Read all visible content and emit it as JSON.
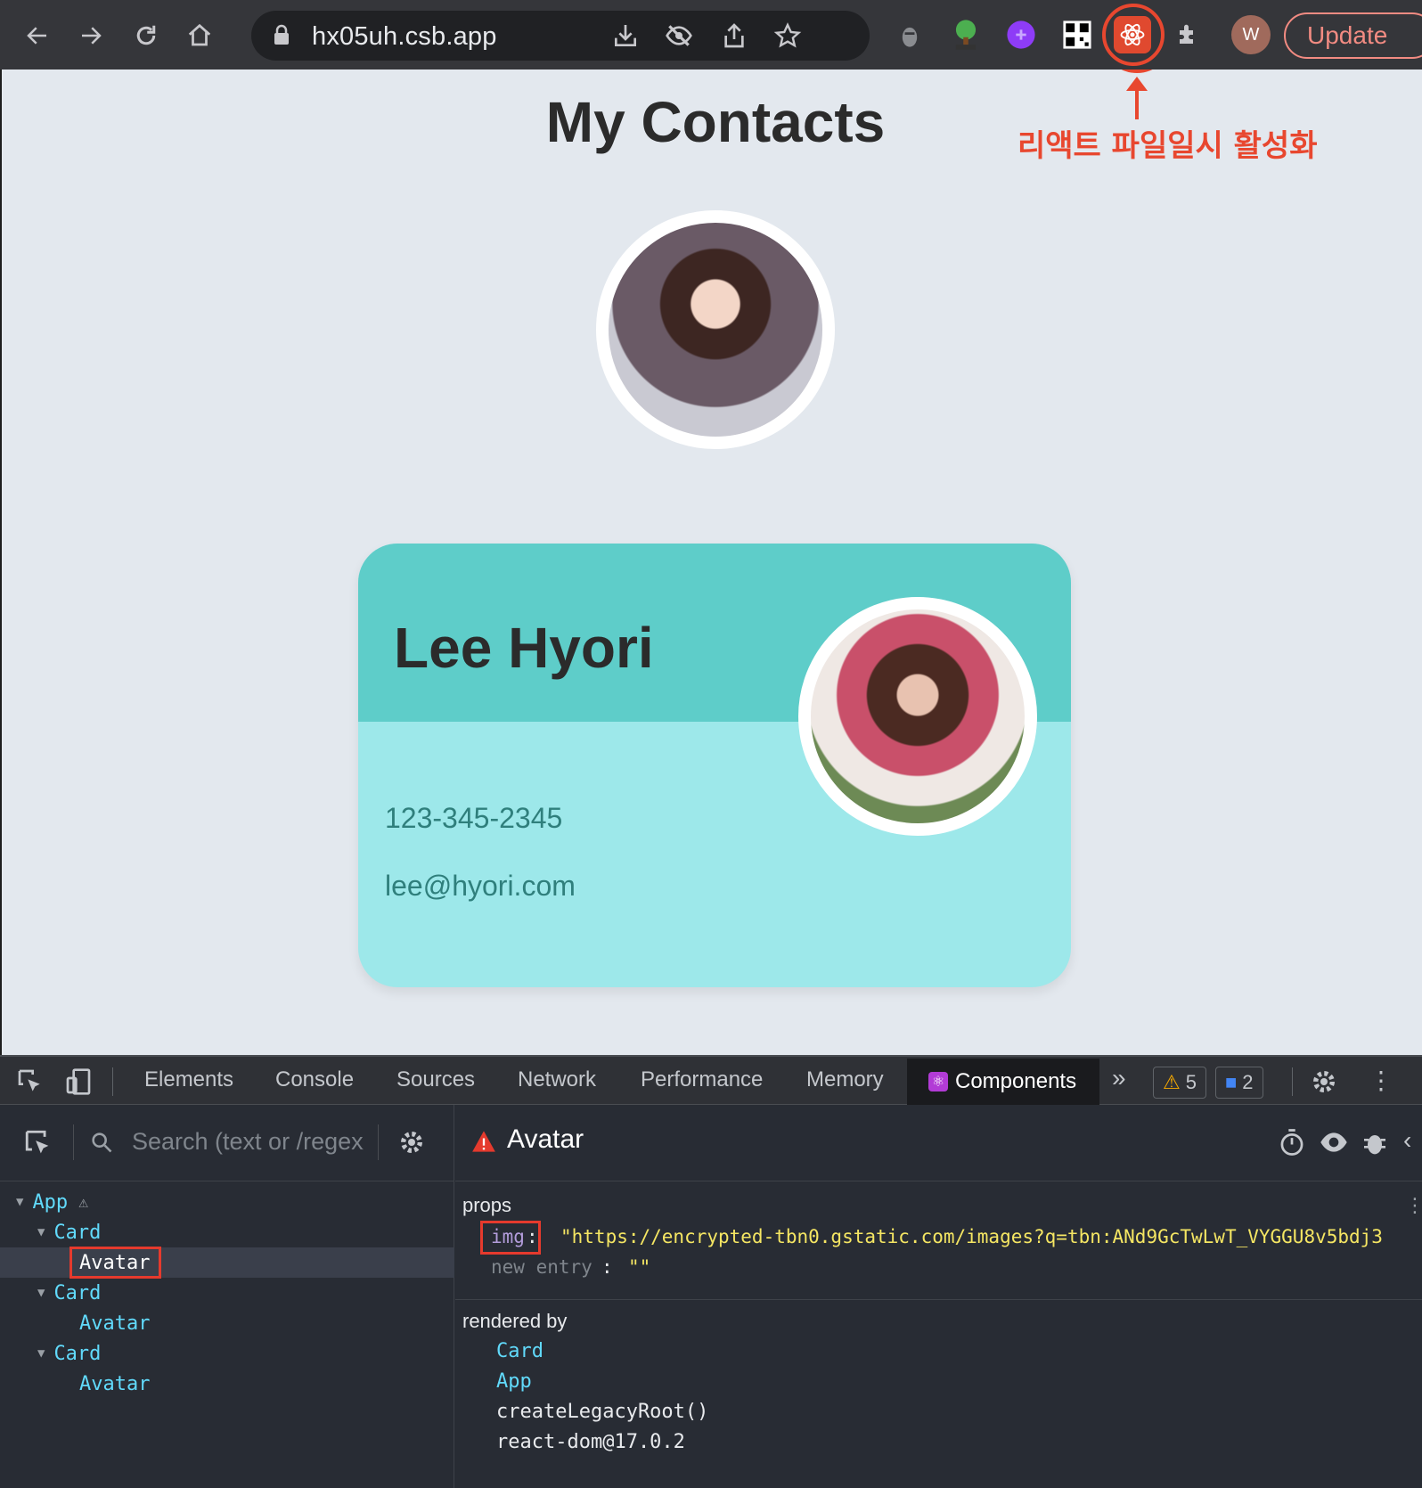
{
  "browser": {
    "url": "hx05uh.csb.app",
    "profile_initial": "W",
    "update_label": "Update"
  },
  "page": {
    "title": "My Contacts",
    "annotation": "리액트 파일일시 활성화",
    "card": {
      "name": "Lee Hyori",
      "phone": "123-345-2345",
      "email": "lee@hyori.com"
    }
  },
  "devtools": {
    "tabs": [
      "Elements",
      "Console",
      "Sources",
      "Network",
      "Performance",
      "Memory"
    ],
    "active_tab": "Components",
    "warnings_count": "5",
    "messages_count": "2",
    "search_placeholder": "Search (text or /regex/)",
    "tree": {
      "app": "App",
      "card1": "Card",
      "avatar1": "Avatar",
      "card2": "Card",
      "avatar2": "Avatar",
      "card3": "Card",
      "avatar3": "Avatar"
    },
    "selected_component": "Avatar",
    "props_label": "props",
    "prop_key": "img",
    "prop_value": "\"https://encrypted-tbn0.gstatic.com/images?q=tbn:ANd9GcTwLwT_VYGGU8v5bdj3",
    "new_entry_label": "new entry",
    "new_entry_value": "\"\"",
    "rendered_by_label": "rendered by",
    "rendered_by": [
      "Card",
      "App",
      "createLegacyRoot()",
      "react-dom@17.0.2"
    ]
  },
  "colors": {
    "annotation_red": "#e8472f",
    "card_top": "#5ecdc9",
    "card_bottom": "#9de8ea",
    "component_cyan": "#61dafb",
    "prop_yellow": "#f5e663"
  }
}
